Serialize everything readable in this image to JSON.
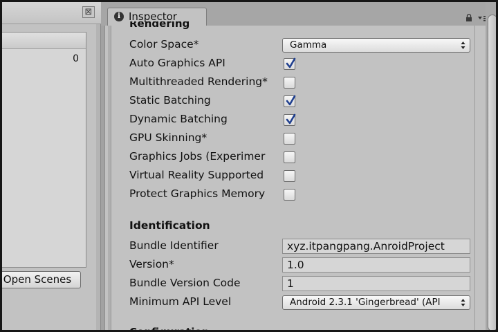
{
  "left_panel": {
    "close_icon": "close-x-icon",
    "close_glyph": "⊠",
    "scene_index": "0",
    "open_scenes_label": "Open Scenes"
  },
  "inspector": {
    "tab_label": "Inspector",
    "tab_icon": "info-icon",
    "tab_icon_glyph": "i",
    "section_top_cut": "Rendering",
    "section_bottom_cut": "Configuration",
    "rendering_rows": [
      {
        "label": "Color Space*",
        "type": "dropdown",
        "value": "Gamma"
      },
      {
        "label": "Auto Graphics API",
        "type": "checkbox",
        "checked": true
      },
      {
        "label": "Multithreaded Rendering*",
        "type": "checkbox",
        "checked": false
      },
      {
        "label": "Static Batching",
        "type": "checkbox",
        "checked": true
      },
      {
        "label": "Dynamic Batching",
        "type": "checkbox",
        "checked": true
      },
      {
        "label": "GPU Skinning*",
        "type": "checkbox",
        "checked": false
      },
      {
        "label": "Graphics Jobs (Experimer",
        "type": "checkbox",
        "checked": false
      },
      {
        "label": "Virtual Reality Supported",
        "type": "checkbox",
        "checked": false
      },
      {
        "label": "Protect Graphics Memory",
        "type": "checkbox",
        "checked": false
      }
    ],
    "identification": {
      "header": "Identification",
      "rows": [
        {
          "label": "Bundle Identifier",
          "type": "text",
          "value": "xyz.itpangpang.AnroidProject"
        },
        {
          "label": "Version*",
          "type": "text",
          "value": "1.0"
        },
        {
          "label": "Bundle Version Code",
          "type": "text",
          "value": "1"
        },
        {
          "label": "Minimum API Level",
          "type": "dropdown",
          "value": "Android 2.3.1 'Gingerbread' (API"
        }
      ]
    }
  },
  "colors": {
    "panel_bg": "#c2c2c2",
    "check_color": "#1f3f8f",
    "frame": "#161616"
  }
}
